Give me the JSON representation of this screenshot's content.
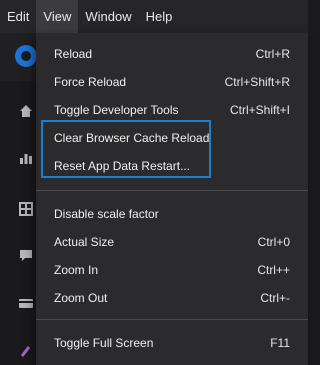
{
  "menubar": {
    "items": [
      {
        "label": "Edit"
      },
      {
        "label": "View"
      },
      {
        "label": "Window"
      },
      {
        "label": "Help"
      }
    ]
  },
  "view_menu": {
    "items": [
      {
        "label": "Reload",
        "shortcut": "Ctrl+R"
      },
      {
        "label": "Force Reload",
        "shortcut": "Ctrl+Shift+R"
      },
      {
        "label": "Toggle Developer Tools",
        "shortcut": "Ctrl+Shift+I"
      },
      {
        "label": "Clear Browser Cache  Reload",
        "shortcut": ""
      },
      {
        "label": "Reset App Data  Restart...",
        "shortcut": ""
      },
      {
        "label": "Disable scale factor",
        "shortcut": ""
      },
      {
        "label": "Actual Size",
        "shortcut": "Ctrl+0"
      },
      {
        "label": "Zoom In",
        "shortcut": "Ctrl++"
      },
      {
        "label": "Zoom Out",
        "shortcut": "Ctrl+-"
      },
      {
        "label": "Toggle Full Screen",
        "shortcut": "F11"
      }
    ]
  },
  "colors": {
    "highlight_border": "#1a7fd0",
    "menu_background": "#2b2b2d",
    "menubar_background": "#262628"
  },
  "sidebar_icons": [
    "home-icon",
    "chart-icon",
    "grid-icon",
    "chat-icon",
    "card-icon",
    "brush-icon"
  ]
}
